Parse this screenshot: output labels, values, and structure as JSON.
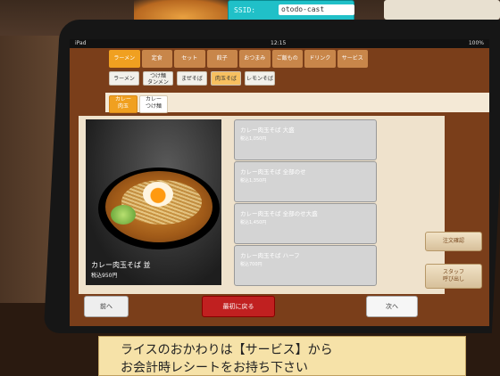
{
  "wifi": {
    "ssid_label": "SSID:",
    "ssid_value": "otodo-cast"
  },
  "status": {
    "device": "iPad",
    "time": "12:15",
    "battery": "100%"
  },
  "categories": [
    {
      "label": "ラーメン",
      "active": true
    },
    {
      "label": "定食",
      "active": false
    },
    {
      "label": "セット",
      "active": false
    },
    {
      "label": "餃子",
      "active": false
    },
    {
      "label": "おつまみ",
      "active": false
    },
    {
      "label": "ご飯もの",
      "active": false
    },
    {
      "label": "ドリンク",
      "active": false
    },
    {
      "label": "サービス",
      "active": false
    }
  ],
  "subcategories": [
    {
      "label": "ラーメン",
      "active": false
    },
    {
      "label": "つけ麺\nタンメン",
      "active": false
    },
    {
      "label": "まぜそば",
      "active": false
    },
    {
      "label": "肉玉そば",
      "active": true
    },
    {
      "label": "レモンそば",
      "active": false
    }
  ],
  "types": [
    {
      "label": "カレー\n肉玉",
      "active": true
    },
    {
      "label": "カレー\nつけ麺",
      "active": false
    }
  ],
  "featured": {
    "name": "カレー肉玉そば 並",
    "price": "税込950円"
  },
  "items": [
    {
      "name": "カレー肉玉そば 大盛",
      "price": "税込1,050円"
    },
    {
      "name": "カレー肉玉そば 全部のせ",
      "price": "税込1,350円"
    },
    {
      "name": "カレー肉玉そば 全部のせ大盛",
      "price": "税込1,450円"
    },
    {
      "name": "カレー肉玉そば ハーフ",
      "price": "税込700円"
    }
  ],
  "side_buttons": {
    "order_confirm": "注文確認",
    "call_staff": "スタッフ\n呼び出し"
  },
  "nav": {
    "prev": "前へ",
    "home": "最初に戻る",
    "next": "次へ"
  },
  "notice": {
    "line1": "ライスのおかわりは【サービス】から",
    "line2": "お会計時レシートをお持ち下さい"
  }
}
